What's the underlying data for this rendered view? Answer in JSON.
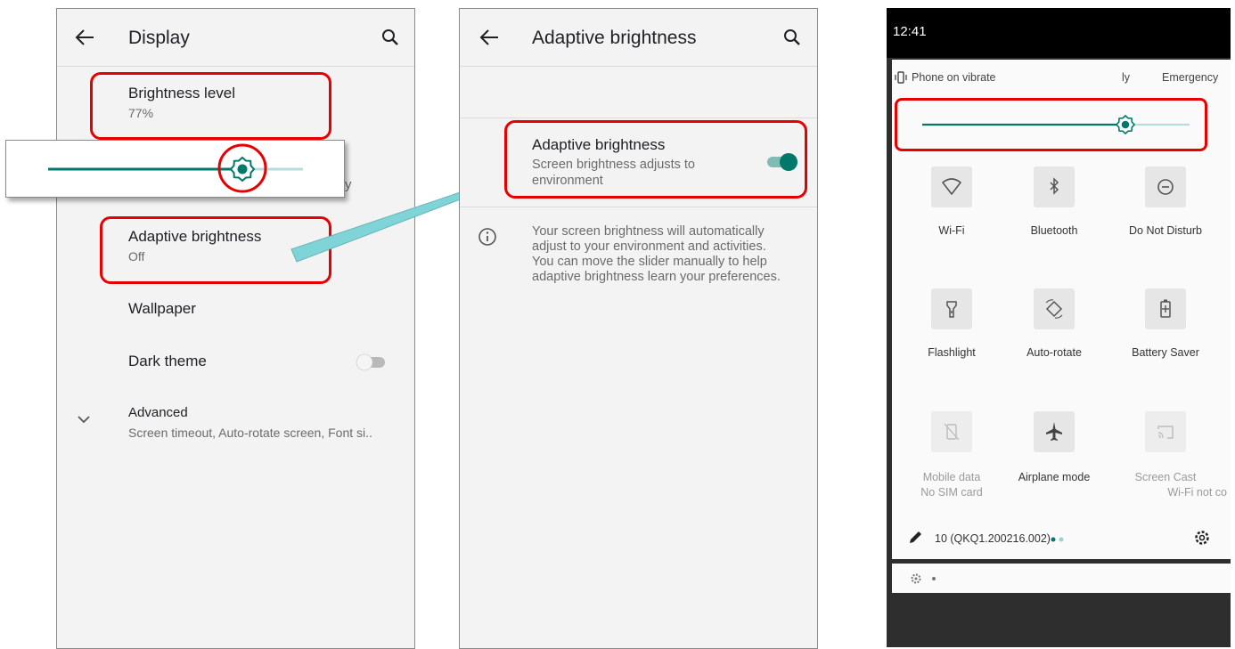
{
  "colors": {
    "accent": "#00796b",
    "highlight": "#e60000",
    "arrow": "#7fd4d8"
  },
  "display_screen": {
    "title": "Display",
    "items": [
      {
        "title": "Brightness level",
        "sub": "77%"
      },
      {
        "title": "Adaptive brightness",
        "sub": "Off"
      },
      {
        "title": "Wallpaper"
      },
      {
        "title": "Dark theme",
        "toggle_on": false
      },
      {
        "title": "Advanced",
        "sub": "Screen timeout, Auto-rotate screen, Font si.."
      }
    ],
    "hidden_fragment": "y",
    "brightness_fraction": 0.77
  },
  "adaptive_screen": {
    "title": "Adaptive brightness",
    "toggle": {
      "title": "Adaptive brightness",
      "sub_line1": "Screen brightness adjusts to",
      "sub_line2": "environment",
      "on": true
    },
    "info_lines": [
      "Your screen brightness will automatically",
      "adjust to your environment and activities.",
      "You can move the slider manually to help",
      "adaptive brightness learn your preferences."
    ]
  },
  "quick_settings": {
    "time": "12:41",
    "header_left": "Phone on vibrate",
    "header_mid": "ly",
    "header_right": "Emergency",
    "brightness_fraction": 0.77,
    "tiles": [
      {
        "label": "Wi-Fi",
        "icon": "wifi-icon"
      },
      {
        "label": "Bluetooth",
        "icon": "bluetooth-icon"
      },
      {
        "label": "Do Not Disturb",
        "icon": "do-not-disturb-icon"
      },
      {
        "label": "Flashlight",
        "icon": "flashlight-icon"
      },
      {
        "label": "Auto-rotate",
        "icon": "auto-rotate-icon"
      },
      {
        "label": "Battery Saver",
        "icon": "battery-saver-icon"
      },
      {
        "label": "Mobile data",
        "sub": "No SIM card",
        "icon": "mobile-data-icon"
      },
      {
        "label": "Airplane mode",
        "icon": "airplane-icon"
      },
      {
        "label": "Screen Cast",
        "sub": "Wi-Fi not co",
        "icon": "screen-cast-icon"
      }
    ],
    "build": "10 (QKQ1.200216.002)"
  }
}
